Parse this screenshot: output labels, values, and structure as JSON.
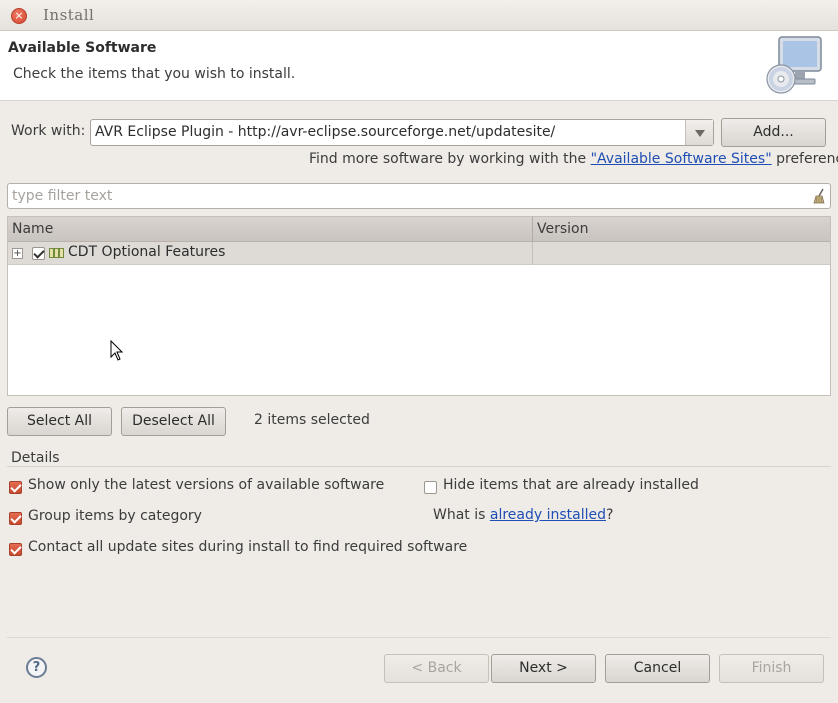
{
  "window": {
    "title": "Install"
  },
  "header": {
    "title": "Available Software",
    "subtitle": "Check the items that you wish to install."
  },
  "work_with": {
    "label": "Work with:",
    "value": "AVR Eclipse Plugin - http://avr-eclipse.sourceforge.net/updatesite/",
    "add_button": "Add..."
  },
  "find_more": {
    "prefix": "Find more software by working with the ",
    "link": "\"Available Software Sites\"",
    "suffix": " preferences."
  },
  "filter": {
    "placeholder": "type filter text"
  },
  "table": {
    "columns": [
      "Name",
      "Version"
    ],
    "rows": [
      {
        "name": "CDT Optional Features",
        "version": "",
        "checked": true,
        "expand": "+"
      }
    ]
  },
  "selection": {
    "select_all": "Select All",
    "deselect_all": "Deselect All",
    "status": "2 items selected"
  },
  "details": {
    "title": "Details",
    "options": [
      {
        "label": "Show only the latest versions of available software",
        "checked": true
      },
      {
        "label": "Group items by category",
        "checked": true
      },
      {
        "label": "Contact all update sites during install to find required software",
        "checked": true
      },
      {
        "label": "Hide items that are already installed",
        "checked": false
      }
    ],
    "what_is": {
      "prefix": "What is ",
      "link": "already installed",
      "suffix": "?"
    }
  },
  "footer": {
    "help": "?",
    "back": "< Back",
    "next": "Next >",
    "cancel": "Cancel",
    "finish": "Finish"
  },
  "colors": {
    "accent_check": "#d4553a",
    "link": "#1f4fb4",
    "window_bg": "#efebe7"
  }
}
